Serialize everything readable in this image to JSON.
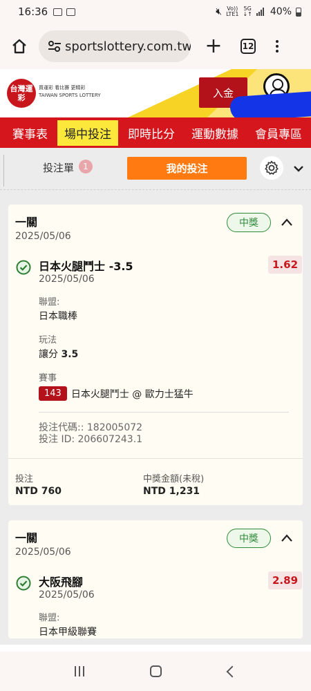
{
  "status_bar": {
    "time": "16:36",
    "network_top": "Vo))",
    "network_bottom": "LTE1",
    "gen_top": "5G",
    "battery": "40%"
  },
  "browser": {
    "url": "sportslottery.com.tw",
    "tab_count": "12"
  },
  "site": {
    "logo_text": "台灣運彩",
    "logo_tagline_1": "買運彩  看比賽  更精彩",
    "logo_tagline_2": "TAIWAN SPORTS LOTTERY",
    "deposit_label": "入金",
    "nav": [
      "賽事表",
      "場中投注",
      "即時比分",
      "運動數據",
      "會員專區"
    ]
  },
  "betslip": {
    "label": "投注單",
    "badge": "1",
    "my_bets_label": "我的投注"
  },
  "cards": [
    {
      "title": "一關",
      "date": "2025/05/06",
      "status": "中獎",
      "selection": "日本火腿鬥士 -3.5",
      "selection_date": "2025/05/06",
      "odds": "1.62",
      "league_label": "聯盟:",
      "league": "日本職棒",
      "market_label": "玩法",
      "market_text": "讓分",
      "market_value": "3.5",
      "event_label": "賽事",
      "event_number": "143",
      "event_name": "日本火腿鬥士 @ 歐力士猛牛",
      "bet_code": "投注代碼:: 182005072",
      "bet_id": "投注 ID: 206607243.1",
      "stake_label": "投注",
      "stake": "NTD 760",
      "payout_label": "中獎金額(未稅)",
      "payout": "NTD 1,231"
    },
    {
      "title": "一關",
      "date": "2025/05/06",
      "status": "中獎",
      "selection": "大阪飛腳",
      "selection_date": "2025/05/06",
      "odds": "2.89",
      "league_label": "聯盟:",
      "league": "日本甲級聯賽"
    }
  ],
  "icons": {
    "home": "home-icon",
    "tune": "tune-icon",
    "plus": "plus-icon",
    "more": "more-vert-icon",
    "gear": "gear-icon",
    "chevron_down": "chevron-down-icon",
    "chevron_up": "chevron-up-icon",
    "check": "check-circle-icon",
    "account": "account-icon"
  },
  "colors": {
    "brand_red": "#d5161d",
    "nav_active": "#fbe83b",
    "my_bets_orange": "#ff7a10",
    "win_green": "#2e8a3a",
    "odds_red": "#c8161d"
  }
}
